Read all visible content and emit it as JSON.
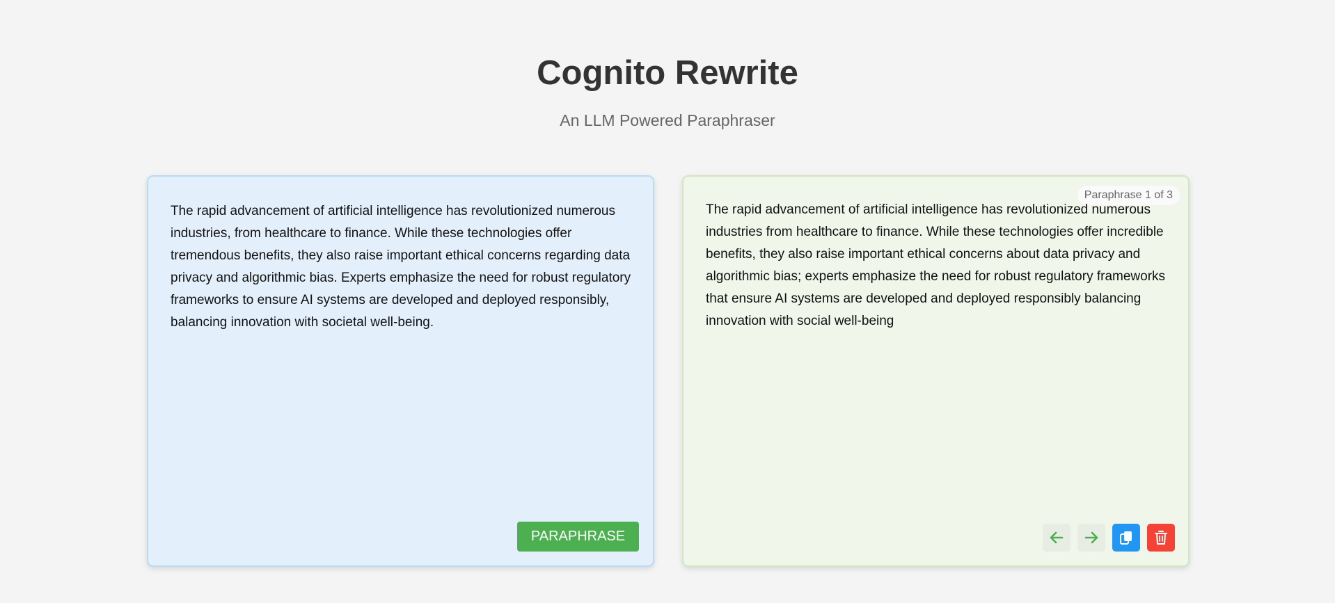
{
  "app": {
    "title": "Cognito Rewrite",
    "subtitle": "An LLM Powered Paraphraser"
  },
  "input_panel": {
    "text": "The rapid advancement of artificial intelligence has revolutionized numerous industries, from healthcare to finance. While these technologies offer tremendous benefits, they also raise important ethical concerns regarding data privacy and algorithmic bias. Experts emphasize the need for robust regulatory frameworks to ensure AI systems are developed and deployed responsibly, balancing innovation with societal well-being.",
    "paraphrase_button_label": "PARAPHRASE"
  },
  "output_panel": {
    "counter": "Paraphrase 1 of 3",
    "text": "The rapid advancement of artificial intelligence has revolutionized numerous industries from healthcare to finance. While these technologies offer incredible benefits, they also raise important ethical concerns about data privacy and algorithmic bias; experts emphasize the need for robust regulatory frameworks that ensure AI systems are developed and deployed responsibly balancing innovation with social well-being",
    "icons": {
      "prev": "arrow-left-icon",
      "next": "arrow-right-icon",
      "copy": "copy-icon",
      "delete": "trash-icon"
    }
  },
  "colors": {
    "background": "#f4f4f4",
    "input_panel_bg": "#e3f0fb",
    "output_panel_bg": "#f0f6ea",
    "paraphrase_button": "#4caf50",
    "nav_arrow": "#4caf50",
    "copy_button": "#2196f3",
    "delete_button": "#f44336"
  }
}
